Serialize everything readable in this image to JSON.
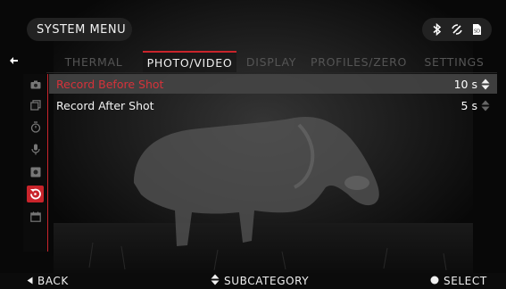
{
  "header": {
    "title": "SYSTEM MENU",
    "status_icons": [
      "bluetooth-icon",
      "wifi-icon",
      "sd-card-icon"
    ]
  },
  "tabs": [
    {
      "label": "THERMAL",
      "active": false
    },
    {
      "label": "PHOTO/VIDEO",
      "active": true
    },
    {
      "label": "DISPLAY",
      "active": false
    },
    {
      "label": "PROFILES/ZERO",
      "active": false
    },
    {
      "label": "SETTINGS",
      "active": false
    }
  ],
  "sidebar": {
    "icons": [
      "camera-icon",
      "gallery-icon",
      "timer-icon",
      "microphone-icon",
      "video-camera-icon",
      "record-shot-icon",
      "calendar-icon"
    ],
    "active": "record-shot-icon"
  },
  "settings": [
    {
      "label": "Record Before Shot",
      "value": "10 s",
      "selected": true
    },
    {
      "label": "Record After Shot",
      "value": "5 s",
      "selected": false
    }
  ],
  "footer": {
    "back": "BACK",
    "subcategory": "SUBCATEGORY",
    "select": "SELECT"
  },
  "colors": {
    "accent": "#c9242b",
    "selected_label": "#d6323a",
    "background": "#050505"
  }
}
